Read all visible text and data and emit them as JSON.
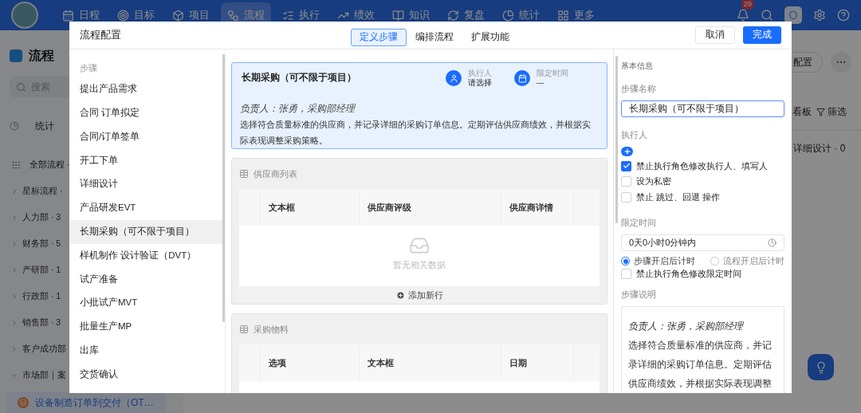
{
  "top_nav": {
    "items": [
      {
        "label": "日程",
        "selected": false
      },
      {
        "label": "目标",
        "selected": false
      },
      {
        "label": "项目",
        "selected": false
      },
      {
        "label": "流程",
        "selected": true
      },
      {
        "label": "执行",
        "selected": false
      },
      {
        "label": "绩效",
        "selected": false
      },
      {
        "label": "知识",
        "selected": false
      },
      {
        "label": "复盘",
        "selected": false
      },
      {
        "label": "统计",
        "selected": false
      },
      {
        "label": "更多",
        "selected": false
      }
    ],
    "notification_count": "29"
  },
  "sidebar": {
    "title": "流程",
    "search_placeholder": "搜索",
    "stats": "统计",
    "items": [
      {
        "kind": "all",
        "label": "全部流程 ·"
      },
      {
        "kind": "group",
        "label": "星标流程 ·",
        "expanded": false
      },
      {
        "kind": "group",
        "label": "人力部 · 3",
        "expanded": false
      },
      {
        "kind": "group",
        "label": "财务部 · 5",
        "expanded": false
      },
      {
        "kind": "group",
        "label": "产研部 · 1",
        "expanded": false
      },
      {
        "kind": "group",
        "label": "行政部 · 1",
        "expanded": false
      },
      {
        "kind": "group",
        "label": "销售部 · 3",
        "expanded": false
      },
      {
        "kind": "group",
        "label": "客户成功部",
        "expanded": false
      },
      {
        "kind": "group",
        "label": "市场部｜案",
        "expanded": true
      }
    ],
    "current_flow": "设备制造订单到交付（OT…"
  },
  "board": {
    "config_button": "配置",
    "view_button": "看板",
    "filter_button": "筛选",
    "column_header": "详细设计 · 0"
  },
  "dialog": {
    "title": "流程配置",
    "tabs": [
      {
        "label": "定义步骤",
        "selected": true
      },
      {
        "label": "编排流程",
        "selected": false
      },
      {
        "label": "扩展功能",
        "selected": false
      }
    ],
    "cancel_button": "取消",
    "done_button": "完成",
    "steps_label": "步骤",
    "steps": [
      {
        "label": "提出产品需求",
        "selected": false
      },
      {
        "label": "合同 订单拟定",
        "selected": false
      },
      {
        "label": "合同/订单签单",
        "selected": false
      },
      {
        "label": "开工下单",
        "selected": false
      },
      {
        "label": "详细设计",
        "selected": false
      },
      {
        "label": "产品研发EVT",
        "selected": false
      },
      {
        "label": "长期采购（可不限于项目）",
        "selected": true
      },
      {
        "label": "样机制作 设计验证（DVT）",
        "selected": false
      },
      {
        "label": "试产准备",
        "selected": false
      },
      {
        "label": "小批试产MVT",
        "selected": false
      },
      {
        "label": "批量生产MP",
        "selected": false
      },
      {
        "label": "出库",
        "selected": false
      },
      {
        "label": "交货确认",
        "selected": false
      }
    ],
    "step_card": {
      "title": "长期采购（可不限于项目）",
      "executor_label": "执行人",
      "executor_value": "请选择",
      "time_label": "限定时间",
      "time_value": "—",
      "owner_line": "负责人：张勇，采购部经理",
      "description": "选择符合质量标准的供应商，并记录详细的采购订单信息。定期评估供应商绩效，并根据实际表现调整采购策略。"
    },
    "tables": [
      {
        "title": "供应商列表",
        "columns": [
          "文本框",
          "供应商评级",
          "供应商详情"
        ],
        "empty_text": "暂无相关数据",
        "add_row": "添加新行"
      },
      {
        "title": "采购物料",
        "columns": [
          "选项",
          "文本框",
          "日期"
        ]
      }
    ],
    "settings": {
      "section_title": "基本信息",
      "name_label": "步骤名称",
      "name_value": "长期采购（可不限于项目）",
      "executor_label": "执行人",
      "options": [
        {
          "label": "禁止执行角色修改执行人、填写人",
          "checked": true
        },
        {
          "label": "设为私密",
          "checked": false
        },
        {
          "label": "禁止 跳过、回退 操作",
          "checked": false
        }
      ],
      "time_label": "限定时间",
      "time_value": "0天0小时0分钟内",
      "timer_modes": [
        {
          "label": "步骤开启后计时",
          "selected": true
        },
        {
          "label": "流程开启后计时",
          "selected": false
        }
      ],
      "time_lock": {
        "label": "禁止执行角色修改限定时间",
        "checked": false
      },
      "description_label": "步骤说明",
      "description_owner": "负责人：张勇，采购部经理",
      "description_text": "选择符合质量标准的供应商，并记录详细的采购订单信息。定期评估供应商绩效，并根据实际表现调整"
    }
  }
}
